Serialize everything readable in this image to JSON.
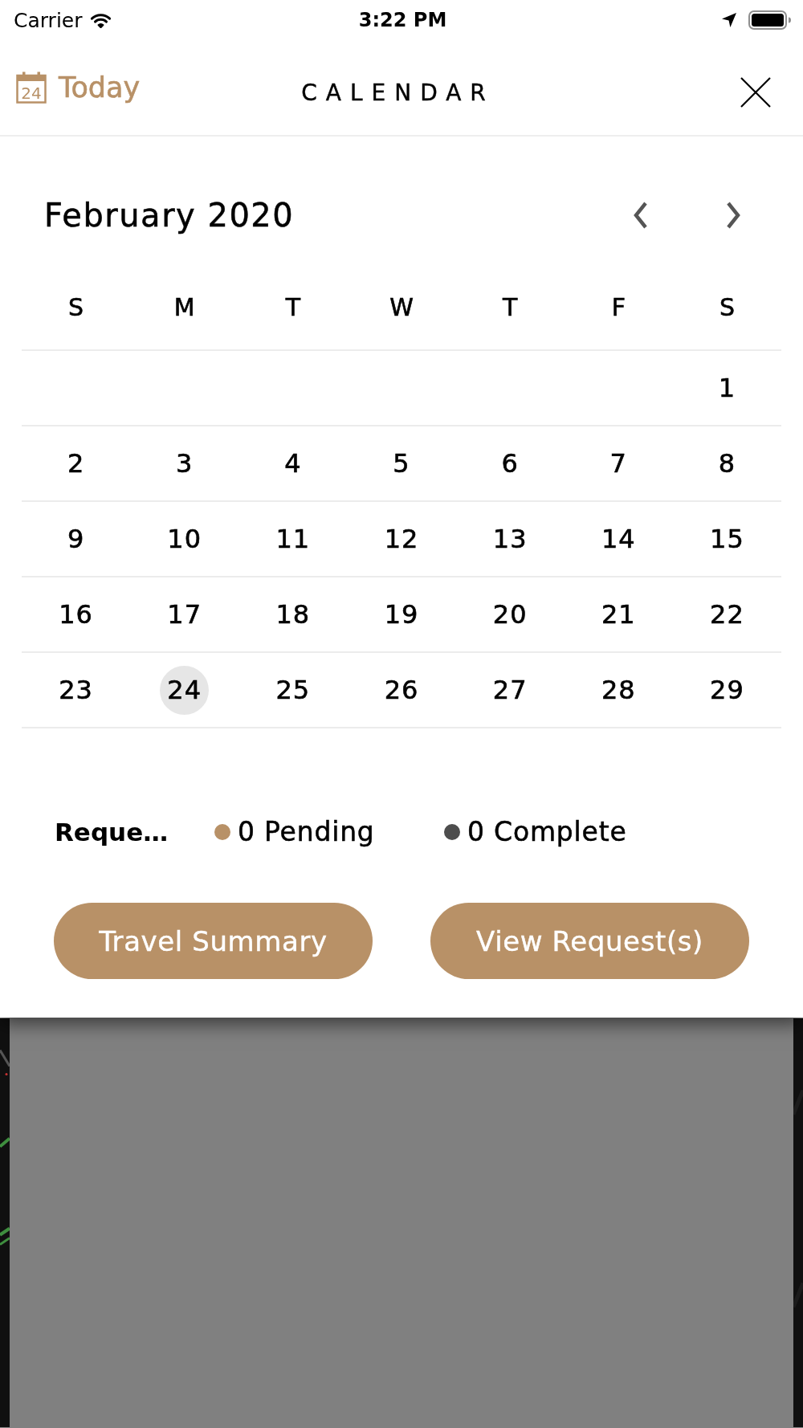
{
  "status_bar": {
    "carrier": "Carrier",
    "time": "3:22 PM"
  },
  "header": {
    "today_button": {
      "icon_day": "24",
      "label": "Today"
    },
    "title": "CALENDAR"
  },
  "calendar": {
    "month_title": "February 2020",
    "weekdays": [
      "S",
      "M",
      "T",
      "W",
      "T",
      "F",
      "S"
    ],
    "weeks": [
      {
        "days": [
          {
            "label": "1",
            "selected": false
          }
        ]
      },
      {
        "days": [
          {
            "label": "2",
            "selected": false
          },
          {
            "label": "3",
            "selected": false
          },
          {
            "label": "4",
            "selected": false
          },
          {
            "label": "5",
            "selected": false
          },
          {
            "label": "6",
            "selected": false
          },
          {
            "label": "7",
            "selected": false
          },
          {
            "label": "8",
            "selected": false
          }
        ]
      },
      {
        "days": [
          {
            "label": "9",
            "selected": false
          },
          {
            "label": "10",
            "selected": false
          },
          {
            "label": "11",
            "selected": false
          },
          {
            "label": "12",
            "selected": false
          },
          {
            "label": "13",
            "selected": false
          },
          {
            "label": "14",
            "selected": false
          },
          {
            "label": "15",
            "selected": false
          }
        ]
      },
      {
        "days": [
          {
            "label": "16",
            "selected": false
          },
          {
            "label": "17",
            "selected": false
          },
          {
            "label": "18",
            "selected": false
          },
          {
            "label": "19",
            "selected": false
          },
          {
            "label": "20",
            "selected": false
          },
          {
            "label": "21",
            "selected": false
          },
          {
            "label": "22",
            "selected": false
          }
        ]
      },
      {
        "days": [
          {
            "label": "23",
            "selected": false
          },
          {
            "label": "24",
            "selected": true
          },
          {
            "label": "25",
            "selected": false
          },
          {
            "label": "26",
            "selected": false
          },
          {
            "label": "27",
            "selected": false
          },
          {
            "label": "28",
            "selected": false
          },
          {
            "label": "29",
            "selected": false
          }
        ]
      }
    ]
  },
  "legend": {
    "title": "Reque…",
    "items": [
      {
        "label": "0 Pending",
        "color": "#b89167"
      },
      {
        "label": "0 Complete",
        "color": "#4d4d4d"
      }
    ]
  },
  "buttons": [
    "Travel Summary",
    "View Request(s)"
  ]
}
